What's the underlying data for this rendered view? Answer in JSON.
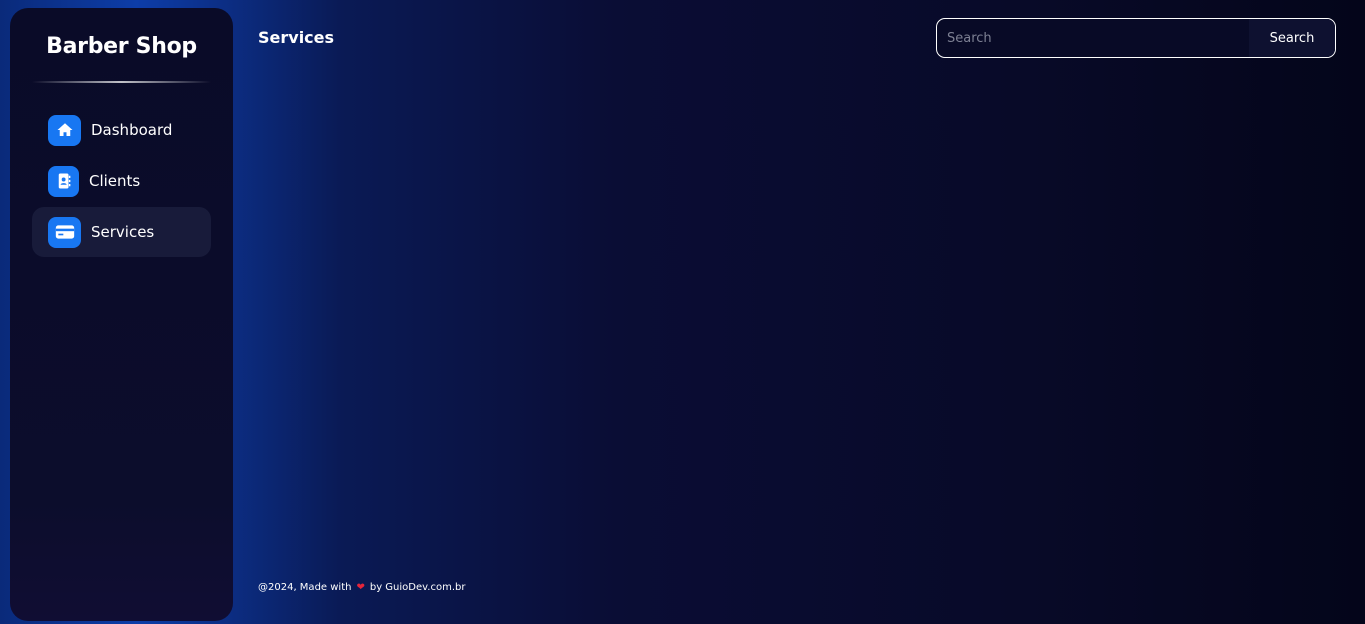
{
  "sidebar": {
    "brand": "Barber Shop",
    "items": [
      {
        "label": "Dashboard",
        "icon": "home-icon",
        "active": false
      },
      {
        "label": "Clients",
        "icon": "contacts-book-icon",
        "active": false
      },
      {
        "label": "Services",
        "icon": "credit-card-icon",
        "active": true
      }
    ]
  },
  "header": {
    "title": "Services",
    "search_placeholder": "Search",
    "search_button": "Search"
  },
  "footer": {
    "prefix": "@2024, Made with",
    "icon": "heart-icon",
    "suffix": "by GuioDev.com.br"
  },
  "colors": {
    "accent": "#1877f2",
    "heart": "#e5253a",
    "sidebar_bg": "#0a0b28",
    "active_item_bg": "#181b3a"
  }
}
